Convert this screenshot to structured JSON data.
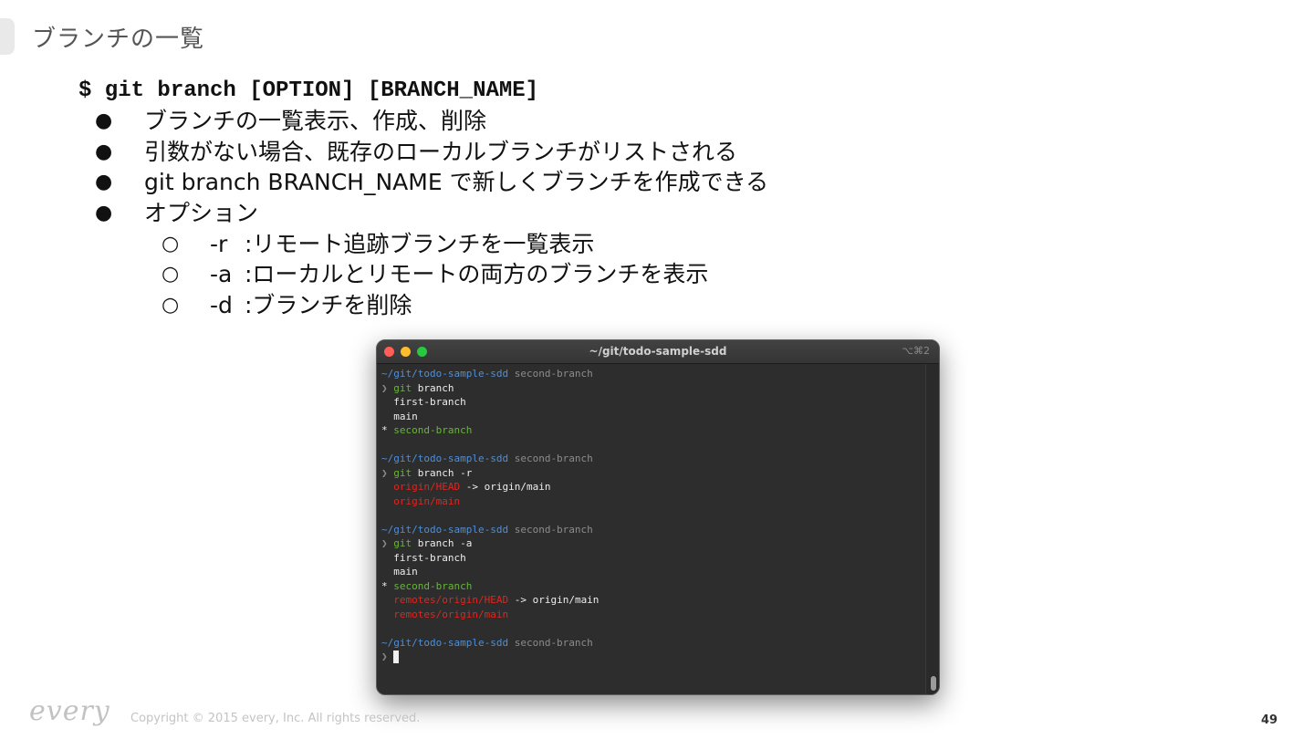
{
  "slide": {
    "title": "ブランチの一覧",
    "command": "$ git branch [OPTION] [BRANCH_NAME]",
    "bullets": [
      {
        "mark": "●",
        "text": "ブランチの一覧表示、作成、削除"
      },
      {
        "mark": "●",
        "text": "引数がない場合、既存のローカルブランチがリストされる"
      },
      {
        "mark": "●",
        "text": "git branch BRANCH_NAME で新しくブランチを作成できる"
      },
      {
        "mark": "●",
        "text": "オプション"
      }
    ],
    "options": [
      {
        "mark": "○",
        "flag": "-r",
        "text": ":リモート追跡ブランチを一覧表示"
      },
      {
        "mark": "○",
        "flag": "-a",
        "text": ":ローカルとリモートの両方のブランチを表示"
      },
      {
        "mark": "○",
        "flag": "-d",
        "text": ":ブランチを削除"
      }
    ],
    "copyright": "Copyright © 2015 every, Inc. All rights reserved.",
    "logo": "every",
    "page_number": "49"
  },
  "terminal": {
    "title": "~/git/todo-sample-sdd",
    "shortcut": "⌥⌘2",
    "path": "~/git/todo-sample-sdd",
    "branch": "second-branch",
    "prompt": "❯",
    "git": "git",
    "star": "*",
    "blocks": [
      {
        "args": "branch",
        "output": [
          {
            "star": false,
            "text": "first-branch",
            "color": "#ededed"
          },
          {
            "star": false,
            "text": "main",
            "color": "#ededed"
          },
          {
            "star": true,
            "text": "second-branch",
            "color": "#68b53a"
          }
        ]
      },
      {
        "args": "branch -r",
        "output": [
          {
            "star": false,
            "text": "origin/HEAD",
            "color": "#e0261f",
            "suffix": " -> origin/main"
          },
          {
            "star": false,
            "text": "origin/main",
            "color": "#e0261f"
          }
        ]
      },
      {
        "args": "branch -a",
        "output": [
          {
            "star": false,
            "text": "first-branch",
            "color": "#ededed"
          },
          {
            "star": false,
            "text": "main",
            "color": "#ededed"
          },
          {
            "star": true,
            "text": "second-branch",
            "color": "#68b53a"
          },
          {
            "star": false,
            "text": "remotes/origin/HEAD",
            "color": "#e0261f",
            "suffix": " -> origin/main"
          },
          {
            "star": false,
            "text": "remotes/origin/main",
            "color": "#e0261f"
          }
        ]
      }
    ],
    "colors": {
      "background": "#2d2d2d",
      "path": "#4f8fd6",
      "git": "#68b53a",
      "remote": "#e0261f",
      "current": "#68b53a"
    }
  }
}
